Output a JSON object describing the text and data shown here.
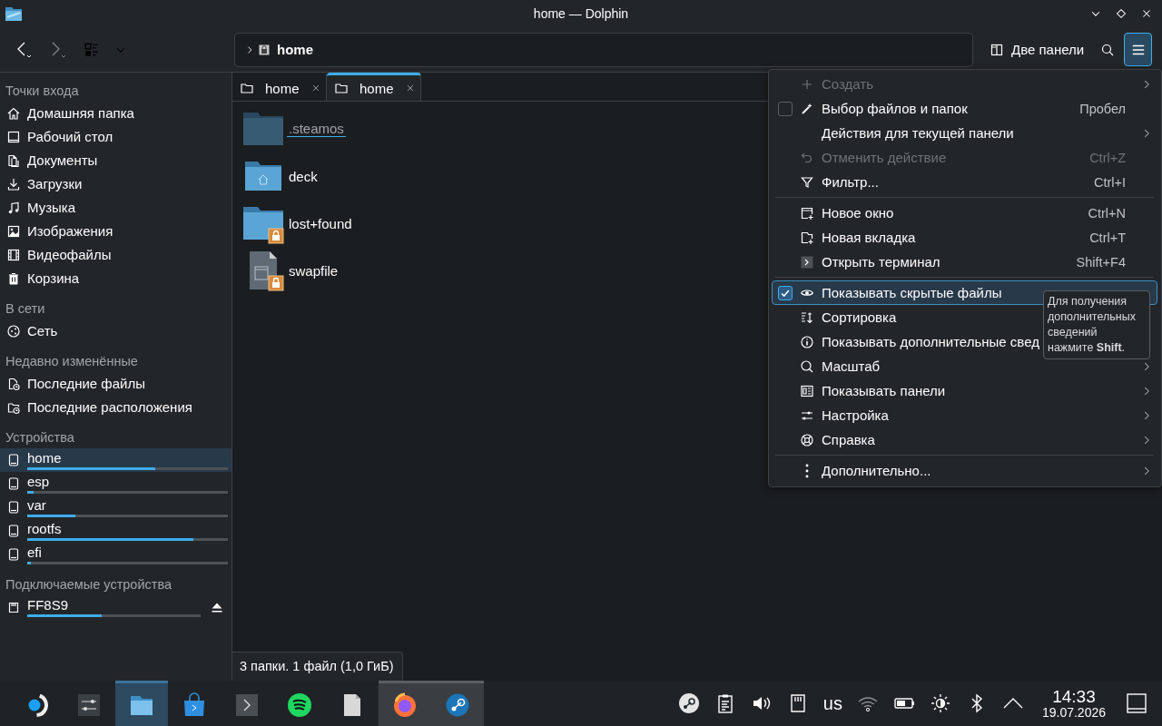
{
  "window": {
    "title": "home — Dolphin"
  },
  "toolbar": {
    "location": "home",
    "split_button": "Две панели"
  },
  "sidebar": {
    "sections": [
      {
        "heading": "Точки входа",
        "items": [
          {
            "label": "Домашняя папка",
            "selected": false
          },
          {
            "label": "Рабочий стол",
            "selected": false
          },
          {
            "label": "Документы",
            "selected": false
          },
          {
            "label": "Загрузки",
            "selected": false
          },
          {
            "label": "Музыка",
            "selected": false
          },
          {
            "label": "Изображения",
            "selected": false
          },
          {
            "label": "Видеофайлы",
            "selected": false
          },
          {
            "label": "Корзина",
            "selected": false
          }
        ]
      },
      {
        "heading": "В сети",
        "items": [
          {
            "label": "Сеть",
            "selected": false
          }
        ]
      },
      {
        "heading": "Недавно изменённые",
        "items": [
          {
            "label": "Последние файлы",
            "selected": false
          },
          {
            "label": "Последние расположения",
            "selected": false
          }
        ]
      },
      {
        "heading": "Устройства",
        "items": [
          {
            "label": "home",
            "selected": true,
            "level": 0.64
          },
          {
            "label": "esp",
            "selected": false,
            "level": 0.03
          },
          {
            "label": "var",
            "selected": false,
            "level": 0.24
          },
          {
            "label": "rootfs",
            "selected": false,
            "level": 0.83
          },
          {
            "label": "efi",
            "selected": false,
            "level": 0.02
          }
        ]
      },
      {
        "heading": "Подключаемые устройства",
        "items": [
          {
            "label": "FF8S9",
            "selected": false,
            "level": 0.43,
            "eject": true
          }
        ]
      }
    ]
  },
  "tabs": [
    {
      "label": "home",
      "selected": false
    },
    {
      "label": "home",
      "selected": true
    }
  ],
  "files": [
    {
      "name": ".steamos",
      "kind": "folder",
      "hidden": true,
      "current": true,
      "locked": false
    },
    {
      "name": "deck",
      "kind": "home-folder",
      "hidden": false,
      "current": false,
      "locked": false
    },
    {
      "name": "lost+found",
      "kind": "folder",
      "hidden": false,
      "current": false,
      "locked": true
    },
    {
      "name": "swapfile",
      "kind": "file",
      "hidden": false,
      "current": false,
      "locked": true
    }
  ],
  "status_bar": "3 папки. 1 файл (1,0 ГиБ)",
  "menu": {
    "items": [
      {
        "kind": "item",
        "label": "Создать",
        "disabled": true,
        "submenu": true
      },
      {
        "kind": "check",
        "label": "Выбор файлов и папок",
        "shortcut": "Пробел",
        "checked": false,
        "highlighted": false
      },
      {
        "kind": "item",
        "label": "Действия для текущей панели",
        "submenu": true
      },
      {
        "kind": "item",
        "label": "Отменить действие",
        "shortcut": "Ctrl+Z",
        "disabled": true
      },
      {
        "kind": "item",
        "label": "Фильтр...",
        "shortcut": "Ctrl+I"
      },
      {
        "kind": "separator"
      },
      {
        "kind": "item",
        "label": "Новое окно",
        "shortcut": "Ctrl+N"
      },
      {
        "kind": "item",
        "label": "Новая вкладка",
        "shortcut": "Ctrl+T"
      },
      {
        "kind": "item",
        "label": "Открыть терминал",
        "shortcut": "Shift+F4"
      },
      {
        "kind": "separator"
      },
      {
        "kind": "check",
        "label": "Показывать скрытые файлы",
        "checked": true,
        "highlighted": true
      },
      {
        "kind": "item",
        "label": "Сортировка"
      },
      {
        "kind": "item",
        "label": "Показывать дополнительные свед"
      },
      {
        "kind": "item",
        "label": "Масштаб",
        "submenu": true
      },
      {
        "kind": "item",
        "label": "Показывать панели",
        "submenu": true
      },
      {
        "kind": "item",
        "label": "Настройка",
        "submenu": true
      },
      {
        "kind": "item",
        "label": "Справка",
        "submenu": true
      },
      {
        "kind": "separator"
      },
      {
        "kind": "item",
        "label": "Дополнительно...",
        "submenu": true
      }
    ]
  },
  "tooltip": "Для получения дополнительных сведений нажмите **Shift**.",
  "taskbar": {
    "apps": [
      {
        "active": false,
        "open": false
      },
      {
        "active": false,
        "open": false
      },
      {
        "active": true,
        "open": true
      },
      {
        "active": false,
        "open": false
      },
      {
        "active": false,
        "open": false
      },
      {
        "active": false,
        "open": false
      },
      {
        "active": false,
        "open": false
      },
      {
        "active": false,
        "open": true
      },
      {
        "active": false,
        "open": true
      }
    ],
    "keyboard": "us",
    "time": "14:33",
    "date": "19.07.2026"
  }
}
